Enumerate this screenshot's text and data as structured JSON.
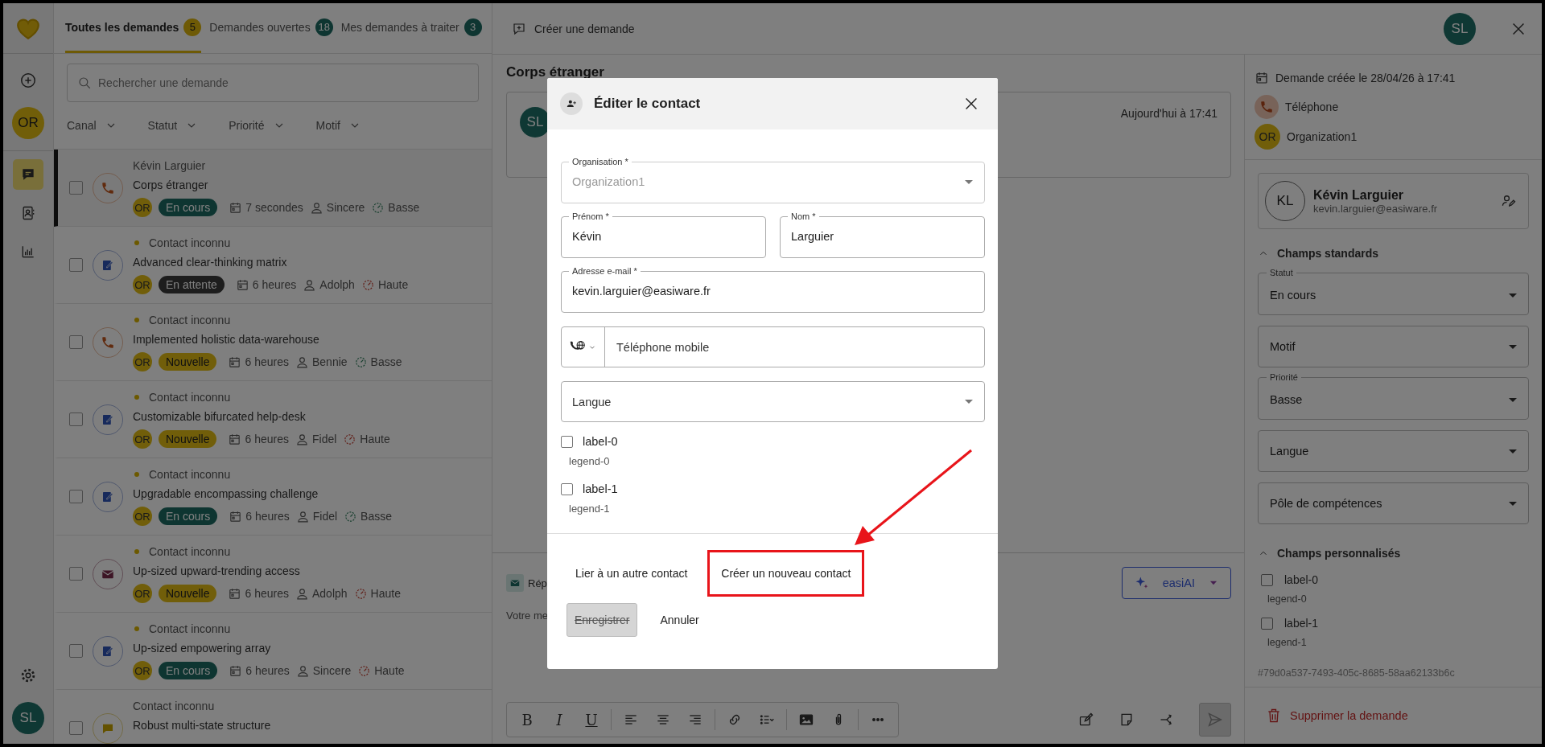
{
  "nav_rail": {
    "org_avatar": "OR",
    "items": [
      {
        "kind": "requests",
        "selected": true
      },
      {
        "kind": "contacts",
        "selected": false
      },
      {
        "kind": "stats",
        "selected": false
      }
    ],
    "user_avatar": "SL"
  },
  "tabs": [
    {
      "label": "Toutes les demandes",
      "count": "5",
      "selected": true
    },
    {
      "label": "Demandes ouvertes",
      "count": "18",
      "selected": false
    },
    {
      "label": "Mes demandes à traiter",
      "count": "3",
      "selected": false
    }
  ],
  "search": {
    "placeholder": "Rechercher une demande"
  },
  "filters": [
    "Canal",
    "Statut",
    "Priorité",
    "Motif"
  ],
  "requests": [
    {
      "contact": "Kévin Larguier",
      "unread": false,
      "title": "Corps étranger",
      "channel": {
        "kind": "phone"
      },
      "checked": false,
      "selected": true,
      "org": "OR",
      "status": {
        "label": "En cours",
        "kind": "in_progress"
      },
      "age": "7 secondes",
      "agent": "Sincere",
      "priority": {
        "label": "Basse",
        "kind": "low"
      }
    },
    {
      "contact": "Contact inconnu",
      "unread": true,
      "title": "Advanced clear-thinking matrix",
      "channel": {
        "kind": "form"
      },
      "checked": false,
      "selected": false,
      "org": "OR",
      "status": {
        "label": "En attente",
        "kind": "waiting"
      },
      "age": "6 heures",
      "agent": "Adolph",
      "priority": {
        "label": "Haute",
        "kind": "high"
      }
    },
    {
      "contact": "Contact inconnu",
      "unread": true,
      "title": "Implemented holistic data-warehouse",
      "channel": {
        "kind": "phone"
      },
      "checked": false,
      "selected": false,
      "org": "OR",
      "status": {
        "label": "Nouvelle",
        "kind": "new"
      },
      "age": "6 heures",
      "agent": "Bennie",
      "priority": {
        "label": "Basse",
        "kind": "low"
      }
    },
    {
      "contact": "Contact inconnu",
      "unread": true,
      "title": "Customizable bifurcated help-desk",
      "channel": {
        "kind": "form"
      },
      "checked": false,
      "selected": false,
      "org": "OR",
      "status": {
        "label": "Nouvelle",
        "kind": "new"
      },
      "age": "6 heures",
      "agent": "Fidel",
      "priority": {
        "label": "Haute",
        "kind": "high"
      }
    },
    {
      "contact": "Contact inconnu",
      "unread": true,
      "title": "Upgradable encompassing challenge",
      "channel": {
        "kind": "form"
      },
      "checked": false,
      "selected": false,
      "org": "OR",
      "status": {
        "label": "En cours",
        "kind": "in_progress"
      },
      "age": "6 heures",
      "agent": "Fidel",
      "priority": {
        "label": "Basse",
        "kind": "low"
      }
    },
    {
      "contact": "Contact inconnu",
      "unread": true,
      "title": "Up-sized upward-trending access",
      "channel": {
        "kind": "email"
      },
      "checked": false,
      "selected": false,
      "org": "OR",
      "status": {
        "label": "Nouvelle",
        "kind": "new"
      },
      "age": "6 heures",
      "agent": "Adolph",
      "priority": {
        "label": "Haute",
        "kind": "high"
      }
    },
    {
      "contact": "Contact inconnu",
      "unread": true,
      "title": "Up-sized empowering array",
      "channel": {
        "kind": "form"
      },
      "checked": false,
      "selected": false,
      "org": "OR",
      "status": {
        "label": "En cours",
        "kind": "in_progress"
      },
      "age": "6 heures",
      "agent": "Sincere",
      "priority": {
        "label": "Haute",
        "kind": "high"
      }
    },
    {
      "contact": "Contact inconnu",
      "unread": false,
      "title": "Robust multi-state structure",
      "channel": {
        "kind": "chat"
      },
      "checked": false,
      "selected": false
    }
  ],
  "detail": {
    "create_button": "Créer une demande",
    "user_avatar": "SL",
    "title": "Corps étranger",
    "message": {
      "avatar": "SL",
      "time": "Aujourd'hui à 17:41"
    },
    "reply": {
      "tab": "Rép",
      "placeholder": "Votre me",
      "ai_button": "easiAI"
    },
    "format_toolbar": {
      "text_buttons": [
        "B",
        "I",
        "U"
      ]
    }
  },
  "side": {
    "created": "Demande créée le 28/04/26 à 17:41",
    "channel": "Téléphone",
    "org_avatar": "OR",
    "org": "Organization1",
    "contact": {
      "initials": "KL",
      "name": "Kévin Larguier",
      "email": "kevin.larguier@easiware.fr"
    },
    "standard": {
      "title": "Champs standards",
      "expanded": true,
      "fields": [
        {
          "label": "Statut",
          "value": "En cours"
        },
        {
          "placeholder": "Motif"
        },
        {
          "label": "Priorité",
          "value": "Basse"
        },
        {
          "placeholder": "Langue"
        },
        {
          "placeholder": "Pôle de compétences"
        }
      ]
    },
    "custom": {
      "title": "Champs personnalisés",
      "expanded": true,
      "checkboxes": [
        {
          "label": "label-0",
          "legend": "legend-0",
          "checked": false
        },
        {
          "label": "label-1",
          "legend": "legend-1",
          "checked": false
        }
      ]
    },
    "id": "#79d0a537-7493-405c-8685-58aa62133b6c",
    "delete": "Supprimer la demande"
  },
  "modal": {
    "title": "Éditer le contact",
    "rows": [
      {
        "fields": [
          {
            "kind": "select",
            "label": "Organisation *",
            "value": "Organization1",
            "disabled": true
          }
        ]
      },
      {
        "fields": [
          {
            "kind": "text",
            "label": "Prénom *",
            "value": "Kévin",
            "disabled": false
          },
          {
            "kind": "text",
            "label": "Nom *",
            "value": "Larguier",
            "disabled": false
          }
        ]
      },
      {
        "fields": [
          {
            "kind": "text",
            "label": "Adresse e-mail *",
            "value": "kevin.larguier@easiware.fr",
            "disabled": false
          }
        ]
      },
      {
        "fields": [
          {
            "kind": "phone",
            "placeholder": "Téléphone mobile",
            "disabled": false
          }
        ]
      },
      {
        "fields": [
          {
            "kind": "select",
            "placeholder": "Langue",
            "disabled": false
          }
        ]
      }
    ],
    "checkboxes": [
      {
        "label": "label-0",
        "legend": "legend-0",
        "checked": false
      },
      {
        "label": "label-1",
        "legend": "legend-1",
        "checked": false
      }
    ],
    "links": [
      {
        "label": "Lier à un autre contact",
        "highlighted": false
      },
      {
        "label": "Créer un nouveau contact",
        "highlighted": true
      }
    ],
    "save": {
      "label": "Enregistrer",
      "disabled": true
    },
    "cancel": "Annuler"
  }
}
